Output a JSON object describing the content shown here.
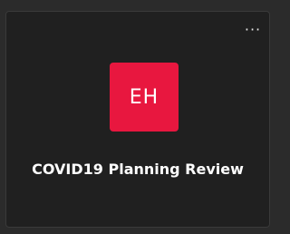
{
  "card": {
    "title": "COVID19 Planning Review",
    "avatar_initials": "EH",
    "more_icon": "more-options-icon",
    "more_glyph": "···"
  },
  "colors": {
    "background": "#2b2b2b",
    "card_background": "#202020",
    "avatar_background": "#e8173f",
    "text": "#ffffff"
  }
}
